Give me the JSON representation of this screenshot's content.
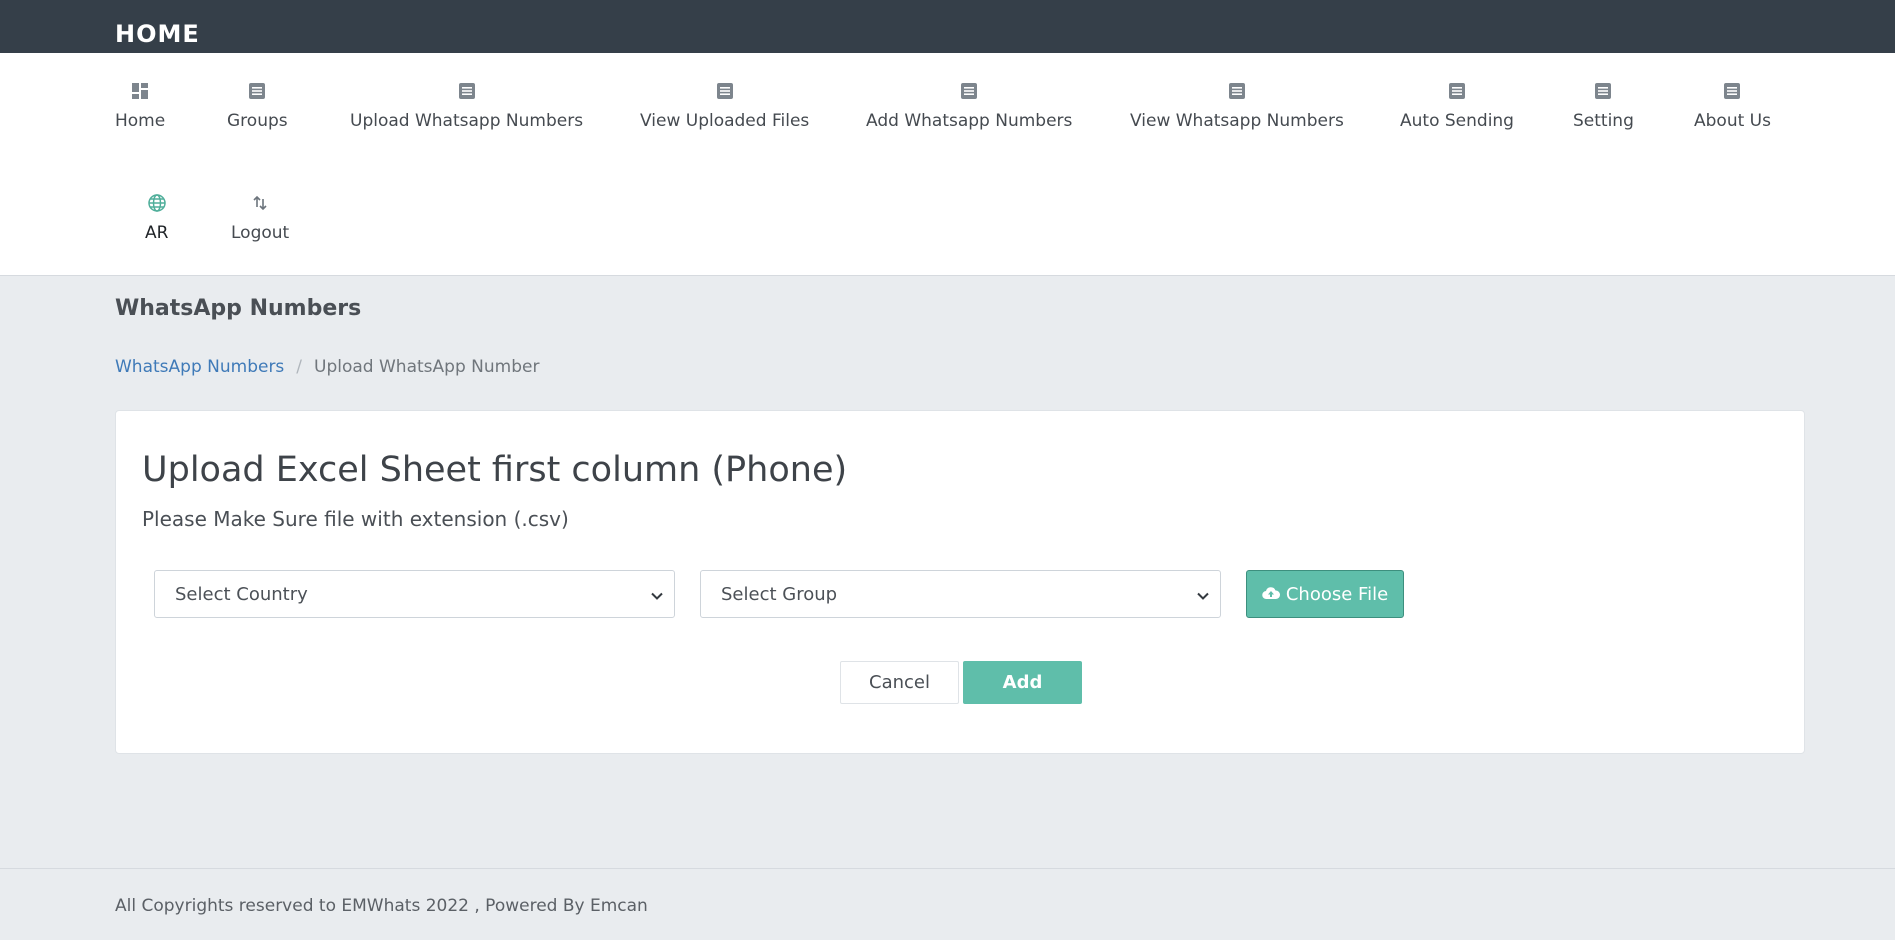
{
  "header": {
    "brand": "HOME"
  },
  "nav": {
    "items": [
      {
        "label": "Home",
        "icon": "dashboard-icon"
      },
      {
        "label": "Groups",
        "icon": "list-icon"
      },
      {
        "label": "Upload Whatsapp Numbers",
        "icon": "list-icon"
      },
      {
        "label": "View Uploaded Files",
        "icon": "list-icon"
      },
      {
        "label": "Add Whatsapp Numbers",
        "icon": "list-icon"
      },
      {
        "label": "View Whatsapp Numbers",
        "icon": "list-icon"
      },
      {
        "label": "Auto Sending",
        "icon": "list-icon"
      },
      {
        "label": "Setting",
        "icon": "list-icon"
      },
      {
        "label": "About Us",
        "icon": "list-icon"
      },
      {
        "label": "AR",
        "icon": "globe-icon"
      },
      {
        "label": "Logout",
        "icon": "swap-icon"
      }
    ]
  },
  "page": {
    "title": "WhatsApp Numbers",
    "breadcrumb": {
      "link": "WhatsApp Numbers",
      "separator": "/",
      "current": "Upload WhatsApp Number"
    }
  },
  "form": {
    "heading": "Upload Excel Sheet first column (Phone)",
    "subheading": "Please Make Sure file with extension (.csv)",
    "country_select": "Select Country",
    "group_select": "Select Group",
    "choose_file": "Choose File",
    "cancel": "Cancel",
    "add": "Add"
  },
  "footer": {
    "text": "All Copyrights reserved to EMWhats 2022 , Powered By Emcan"
  },
  "colors": {
    "topbar": "#353f49",
    "accent": "#5fbeaa",
    "link": "#3f7ab8",
    "background": "#e9ecef"
  }
}
